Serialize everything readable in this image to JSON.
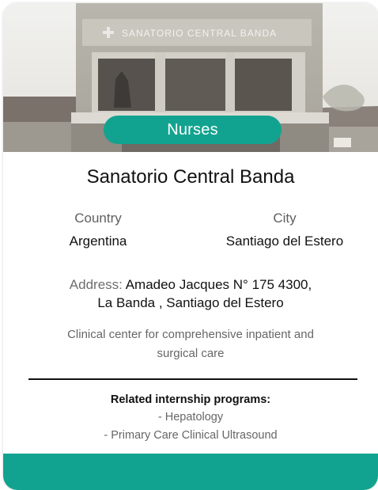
{
  "badge": {
    "label": "Nurses"
  },
  "hero": {
    "sign_text": "SANATORIO CENTRAL BANDA"
  },
  "title": "Sanatorio Central Banda",
  "country": {
    "label": "Country",
    "value": "Argentina"
  },
  "city": {
    "label": "City",
    "value": "Santiago del Estero"
  },
  "address": {
    "label": "Address:",
    "line1": "Amadeo Jacques N° 175 4300,",
    "line2": "La Banda , Santiago del Estero"
  },
  "description": {
    "line1": "Clinical center for comprehensive inpatient and",
    "line2": "surgical care"
  },
  "related": {
    "title": "Related internship programs:",
    "programs": [
      "- Hepatology",
      "- Primary Care Clinical Ultrasound"
    ]
  },
  "colors": {
    "accent": "#12a390"
  }
}
